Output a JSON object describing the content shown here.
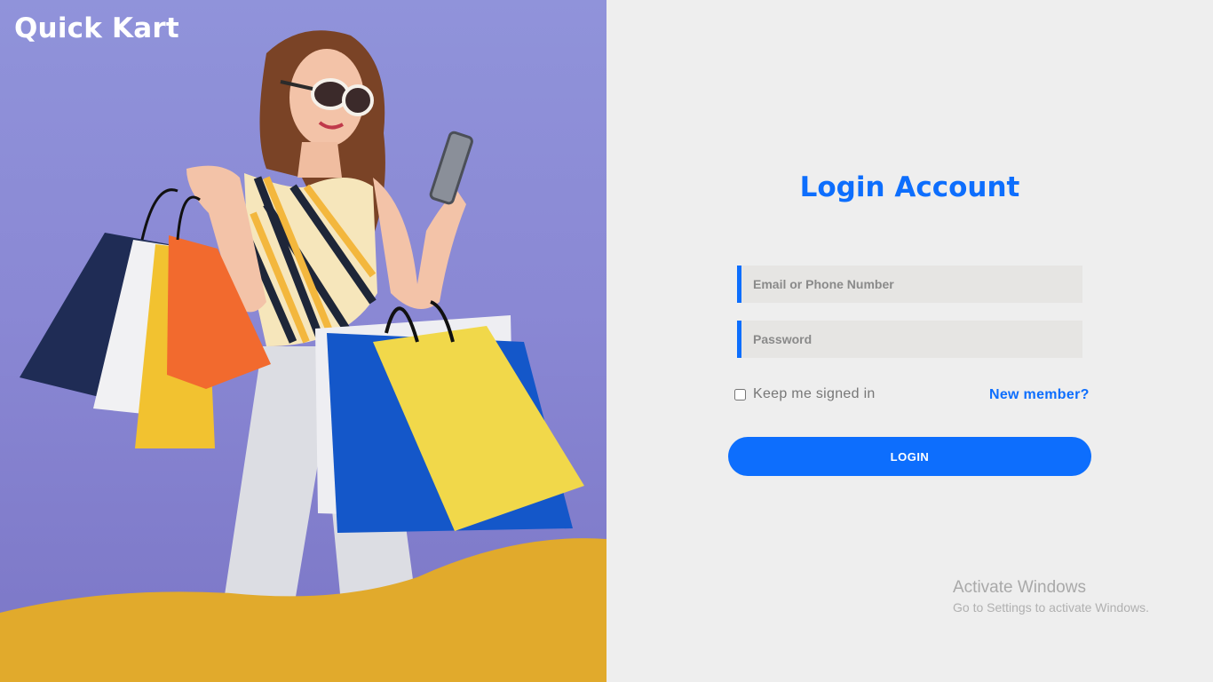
{
  "brand": {
    "name": "Quick Kart"
  },
  "login": {
    "title": "Login Account",
    "email_placeholder": "Email or Phone Number",
    "password_placeholder": "Password",
    "keep_signed_in_label": "Keep me signed in",
    "keep_signed_in_checked": false,
    "new_member_link": "New member?",
    "login_button": "LOGIN"
  },
  "watermark": {
    "title": "Activate Windows",
    "subtitle": "Go to Settings to activate Windows."
  },
  "colors": {
    "accent": "#0d6efd",
    "hero_background": "#8a88d4",
    "hero_wave": "#e1aa2c",
    "panel_background": "#eeeeee"
  }
}
